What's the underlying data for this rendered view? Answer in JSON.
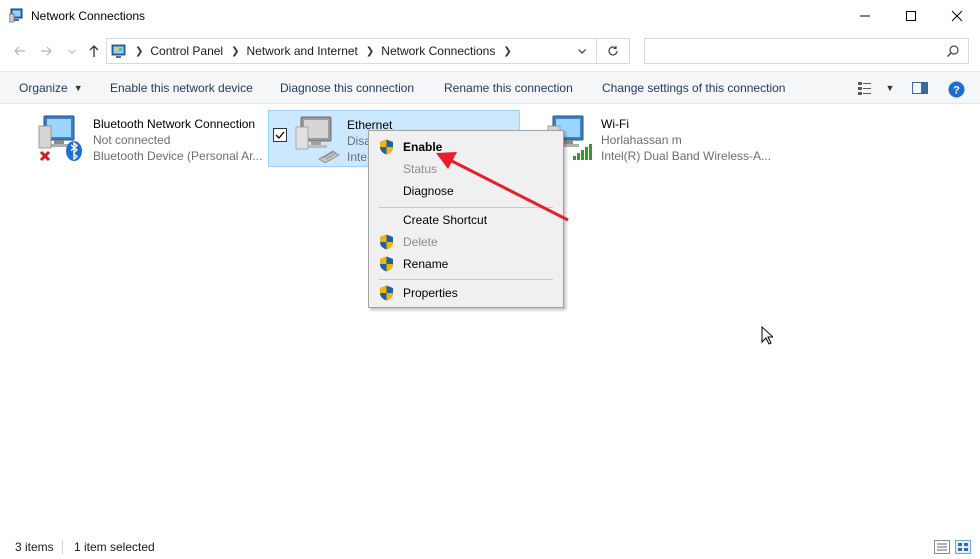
{
  "window": {
    "title": "Network Connections"
  },
  "address": {
    "crumbs": [
      "Control Panel",
      "Network and Internet",
      "Network Connections"
    ],
    "search_placeholder": ""
  },
  "commands": {
    "organize": "Organize",
    "enable": "Enable this network device",
    "diagnose": "Diagnose this connection",
    "rename": "Rename this connection",
    "change": "Change settings of this connection"
  },
  "items": [
    {
      "name": "Bluetooth Network Connection",
      "status": "Not connected",
      "device": "Bluetooth Device (Personal Ar..."
    },
    {
      "name": "Ethernet",
      "status": "Disa",
      "device": "Inte"
    },
    {
      "name": "Wi-Fi",
      "status": "Horlahassan m",
      "device": "Intel(R) Dual Band Wireless-A..."
    }
  ],
  "context_menu": {
    "enable": "Enable",
    "status": "Status",
    "diagnose": "Diagnose",
    "create_shortcut": "Create Shortcut",
    "delete": "Delete",
    "rename": "Rename",
    "properties": "Properties"
  },
  "statusbar": {
    "count": "3 items",
    "selected": "1 item selected"
  },
  "colors": {
    "selection_bg": "#cce8ff",
    "selection_border": "#99d1ff",
    "annotation_arrow": "#e5202b",
    "command_text": "#1e395b"
  }
}
